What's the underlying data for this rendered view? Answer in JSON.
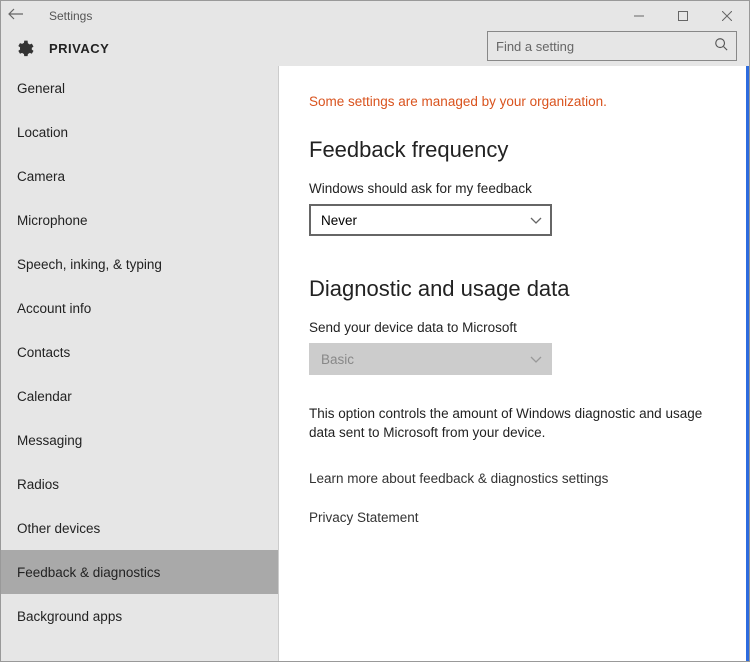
{
  "window": {
    "title": "Settings"
  },
  "header": {
    "section": "PRIVACY",
    "search_placeholder": "Find a setting"
  },
  "sidebar": {
    "items": [
      {
        "label": "General",
        "selected": false
      },
      {
        "label": "Location",
        "selected": false
      },
      {
        "label": "Camera",
        "selected": false
      },
      {
        "label": "Microphone",
        "selected": false
      },
      {
        "label": "Speech, inking, & typing",
        "selected": false
      },
      {
        "label": "Account info",
        "selected": false
      },
      {
        "label": "Contacts",
        "selected": false
      },
      {
        "label": "Calendar",
        "selected": false
      },
      {
        "label": "Messaging",
        "selected": false
      },
      {
        "label": "Radios",
        "selected": false
      },
      {
        "label": "Other devices",
        "selected": false
      },
      {
        "label": "Feedback & diagnostics",
        "selected": true
      },
      {
        "label": "Background apps",
        "selected": false
      }
    ]
  },
  "content": {
    "notice": "Some settings are managed by your organization.",
    "feedback": {
      "heading": "Feedback frequency",
      "label": "Windows should ask for my feedback",
      "value": "Never"
    },
    "diagnostic": {
      "heading": "Diagnostic and usage data",
      "label": "Send your device data to Microsoft",
      "value": "Basic",
      "description": "This option controls the amount of Windows diagnostic and usage data sent to Microsoft from your device."
    },
    "links": {
      "learn_more": "Learn more about feedback & diagnostics settings",
      "privacy": "Privacy Statement"
    }
  }
}
